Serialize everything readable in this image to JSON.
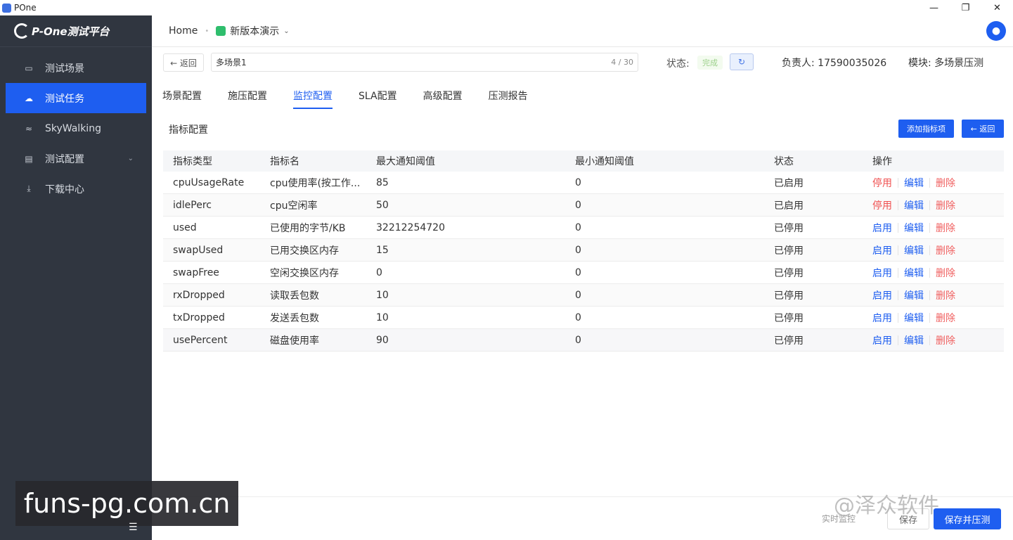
{
  "window": {
    "title": "POne",
    "controls": [
      "—",
      "❐",
      "✕"
    ]
  },
  "sidebar": {
    "logo": "P-One测试平台",
    "items": [
      {
        "label": "测试场景",
        "icon": "calendar-icon",
        "active": false
      },
      {
        "label": "测试任务",
        "icon": "cloud-icon",
        "active": true
      },
      {
        "label": "SkyWalking",
        "icon": "skywalking-icon",
        "active": false
      },
      {
        "label": "测试配置",
        "icon": "config-icon",
        "active": false,
        "has_caret": true
      },
      {
        "label": "下载中心",
        "icon": "download-icon",
        "active": false
      }
    ]
  },
  "header": {
    "home": "Home",
    "project": "新版本演示"
  },
  "toolbar": {
    "back_label": "← 返回",
    "scene_name": "多场景1",
    "scene_counter": "4 / 30",
    "status_label": "状态:",
    "status_value": "完成",
    "owner": "负责人: 17590035026",
    "module": "模块: 多场景压测"
  },
  "tabs": [
    "场景配置",
    "施压配置",
    "监控配置",
    "SLA配置",
    "高级配置",
    "压测报告"
  ],
  "active_tab": "监控配置",
  "section": {
    "title": "指标配置",
    "add_button": "添加指标项",
    "return_button": "← 返回"
  },
  "table": {
    "headers": [
      "指标类型",
      "指标名",
      "最大通知阈值",
      "最小通知阈值",
      "状态",
      "操作"
    ],
    "rows": [
      {
        "type": "cpuUsageRate",
        "name": "cpu使用率(按工作...",
        "max": "85",
        "min": "0",
        "status": "已启用",
        "toggle": "停用"
      },
      {
        "type": "idlePerc",
        "name": "cpu空闲率",
        "max": "50",
        "min": "0",
        "status": "已启用",
        "toggle": "停用"
      },
      {
        "type": "used",
        "name": "已使用的字节/KB",
        "max": "32212254720",
        "min": "0",
        "status": "已停用",
        "toggle": "启用"
      },
      {
        "type": "swapUsed",
        "name": "已用交换区内存",
        "max": "15",
        "min": "0",
        "status": "已停用",
        "toggle": "启用"
      },
      {
        "type": "swapFree",
        "name": "空闲交换区内存",
        "max": "0",
        "min": "0",
        "status": "已停用",
        "toggle": "启用"
      },
      {
        "type": "rxDropped",
        "name": "读取丢包数",
        "max": "10",
        "min": "0",
        "status": "已停用",
        "toggle": "启用"
      },
      {
        "type": "txDropped",
        "name": "发送丢包数",
        "max": "10",
        "min": "0",
        "status": "已停用",
        "toggle": "启用"
      },
      {
        "type": "usePercent",
        "name": "磁盘使用率",
        "max": "90",
        "min": "0",
        "status": "已停用",
        "toggle": "启用"
      }
    ],
    "edit_label": "编辑",
    "delete_label": "删除"
  },
  "footer": {
    "preview": "实时监控",
    "save": "保存",
    "save_run": "保存并压测"
  },
  "watermarks": {
    "left": "funs-pg.com.cn",
    "right": "@泽众软件"
  },
  "colors": {
    "primary": "#1e5ef0",
    "sidebar_bg": "#303640",
    "stop": "#f05050",
    "delete": "#f06060"
  }
}
